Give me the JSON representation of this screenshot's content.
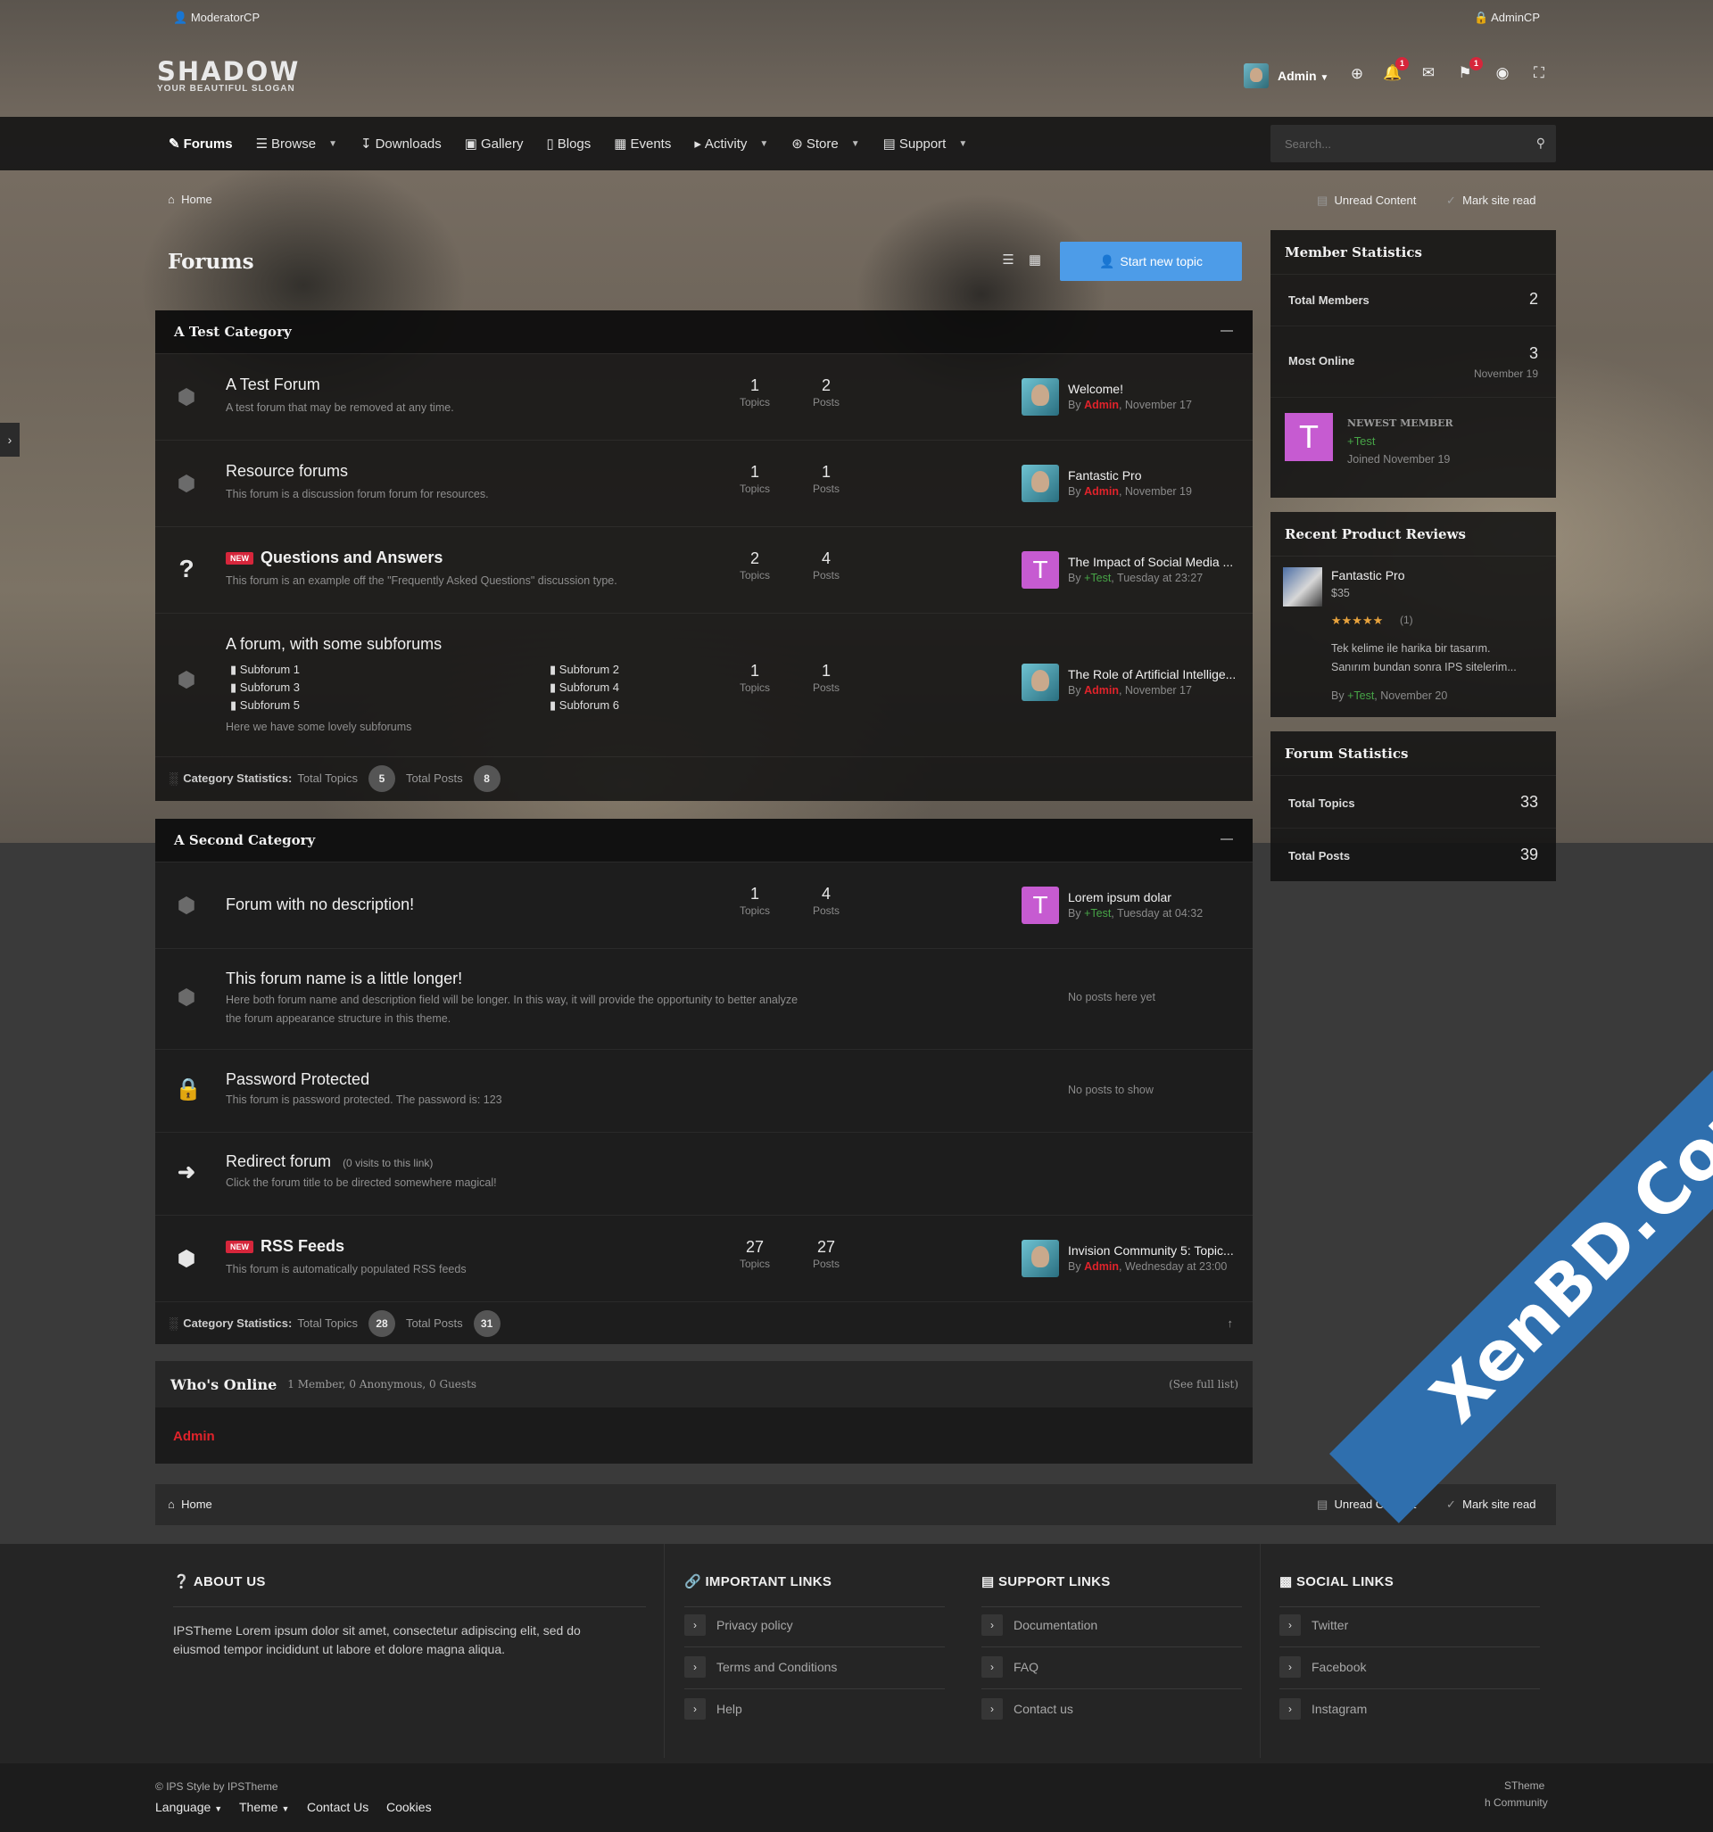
{
  "topbar": {
    "moderator": "ModeratorCP",
    "admin": "AdminCP"
  },
  "brand": {
    "name": "SHADOW",
    "slogan": "YOUR BEAUTIFUL SLOGAN"
  },
  "user": {
    "name": "Admin",
    "notifications": "1",
    "reports": "1"
  },
  "nav": {
    "items": [
      "Forums",
      "Browse",
      "Downloads",
      "Gallery",
      "Blogs",
      "Events",
      "Activity",
      "Store",
      "Support"
    ]
  },
  "search": {
    "placeholder": "Search..."
  },
  "breadcrumb": {
    "home": "Home",
    "unread": "Unread Content",
    "markread": "Mark site read"
  },
  "page": {
    "title": "Forums",
    "start_topic": "Start new topic"
  },
  "labels": {
    "topics": "Topics",
    "posts": "Posts",
    "by": "By ",
    "cat_stats": "Category Statistics:",
    "total_topics": "Total Topics",
    "total_posts": "Total Posts"
  },
  "cat1": {
    "title": "A Test Category",
    "forums": [
      {
        "name": "A Test Forum",
        "desc": "A test forum that may be removed at any time.",
        "topics": "1",
        "posts": "2",
        "lp_title": "Welcome!",
        "lp_author": "Admin",
        "lp_date": ", November 17"
      },
      {
        "name": "Resource forums",
        "desc": "This forum is a discussion forum forum for resources.",
        "topics": "1",
        "posts": "1",
        "lp_title": "Fantastic Pro",
        "lp_author": "Admin",
        "lp_date": ", November 19"
      },
      {
        "name": "Questions and Answers",
        "new": "NEW",
        "desc": "This forum is an example off the \"Frequently Asked Questions\" discussion type.",
        "topics": "2",
        "posts": "4",
        "lp_title": "The Impact of Social Media ...",
        "lp_author": "+Test",
        "lp_date": ", Tuesday at 23:27",
        "lp_initial": "T"
      },
      {
        "name": "A forum, with some subforums",
        "desc": "Here we have some lovely subforums",
        "topics": "1",
        "posts": "1",
        "lp_title": "The Role of Artificial Intellige...",
        "lp_author": "Admin",
        "lp_date": ", November 17",
        "subforums": [
          "Subforum 1",
          "Subforum 2",
          "Subforum 3",
          "Subforum 4",
          "Subforum 5",
          "Subforum 6"
        ]
      }
    ],
    "stats": {
      "topics": "5",
      "posts": "8"
    }
  },
  "cat2": {
    "title": "A Second Category",
    "forums": [
      {
        "name": "Forum with no description!",
        "topics": "1",
        "posts": "4",
        "lp_title": "Lorem ipsum dolar",
        "lp_author": "+Test",
        "lp_date": ", Tuesday at 04:32",
        "lp_initial": "T"
      },
      {
        "name": "This forum name is a little longer!",
        "desc1": "Here both forum name and description field will be longer. In this way, it will provide the opportunity to better analyze",
        "desc2": "the forum appearance structure in this theme.",
        "nolp": "No posts here yet"
      },
      {
        "name": "Password Protected",
        "desc": "This forum is password protected. The password is: 123",
        "nolp": "No posts to show"
      },
      {
        "name": "Redirect forum",
        "visits": "(0 visits to this link)",
        "desc": "Click the forum title to be directed somewhere magical!"
      },
      {
        "name": "RSS Feeds",
        "new": "NEW",
        "desc": "This forum is automatically populated RSS feeds",
        "topics": "27",
        "posts": "27",
        "lp_title": "Invision Community 5: Topic...",
        "lp_author": "Admin",
        "lp_date": ", Wednesday at 23:00"
      }
    ],
    "stats": {
      "topics": "28",
      "posts": "31"
    }
  },
  "online": {
    "title": "Who's Online",
    "counts": "1 Member, 0 Anonymous, 0 Guests",
    "full": "(See full list)",
    "members": [
      "Admin"
    ]
  },
  "member_stats": {
    "title": "Member Statistics",
    "total_label": "Total Members",
    "total": "2",
    "most_label": "Most Online",
    "most": "3",
    "most_date": "November 19",
    "newest_label": "NEWEST MEMBER",
    "newest_name": "+Test",
    "newest_joined": "Joined November 19",
    "newest_initial": "T"
  },
  "reviews": {
    "title": "Recent Product Reviews",
    "product": "Fantastic Pro",
    "price": "$35",
    "stars": "★★★★★",
    "count": "(1)",
    "text1": "Tek kelime ile harika bir tasarım.",
    "text2": "Sanırım bundan sonra IPS sitelerim...",
    "author": "+Test",
    "date": ", November 20"
  },
  "forum_stats": {
    "title": "Forum Statistics",
    "topics_label": "Total Topics",
    "topics": "33",
    "posts_label": "Total Posts",
    "posts": "39"
  },
  "footer": {
    "about_title": "ABOUT US",
    "about1": "IPSTheme Lorem ipsum dolor sit amet, consectetur adipiscing elit, sed do",
    "about2": "eiusmod tempor incididunt ut labore et dolore magna aliqua.",
    "important_title": "IMPORTANT LINKS",
    "important": [
      "Privacy policy",
      "Terms and Conditions",
      "Help"
    ],
    "support_title": "SUPPORT LINKS",
    "support": [
      "Documentation",
      "FAQ",
      "Contact us"
    ],
    "social_title": "SOCIAL LINKS",
    "social": [
      "Twitter",
      "Facebook",
      "Instagram"
    ],
    "copyright": "IPS Style by IPSTheme",
    "language": "Language",
    "theme": "Theme",
    "contact": "Contact Us",
    "cookies": "Cookies",
    "right1": "STheme",
    "right2": "h Community"
  },
  "watermark": "XenBD.Com",
  "colors": {
    "accent": "#4d9ce8",
    "admin": "#e0232b",
    "test": "#47a447",
    "new": "#d6263b",
    "initial": "#c65bd1"
  }
}
